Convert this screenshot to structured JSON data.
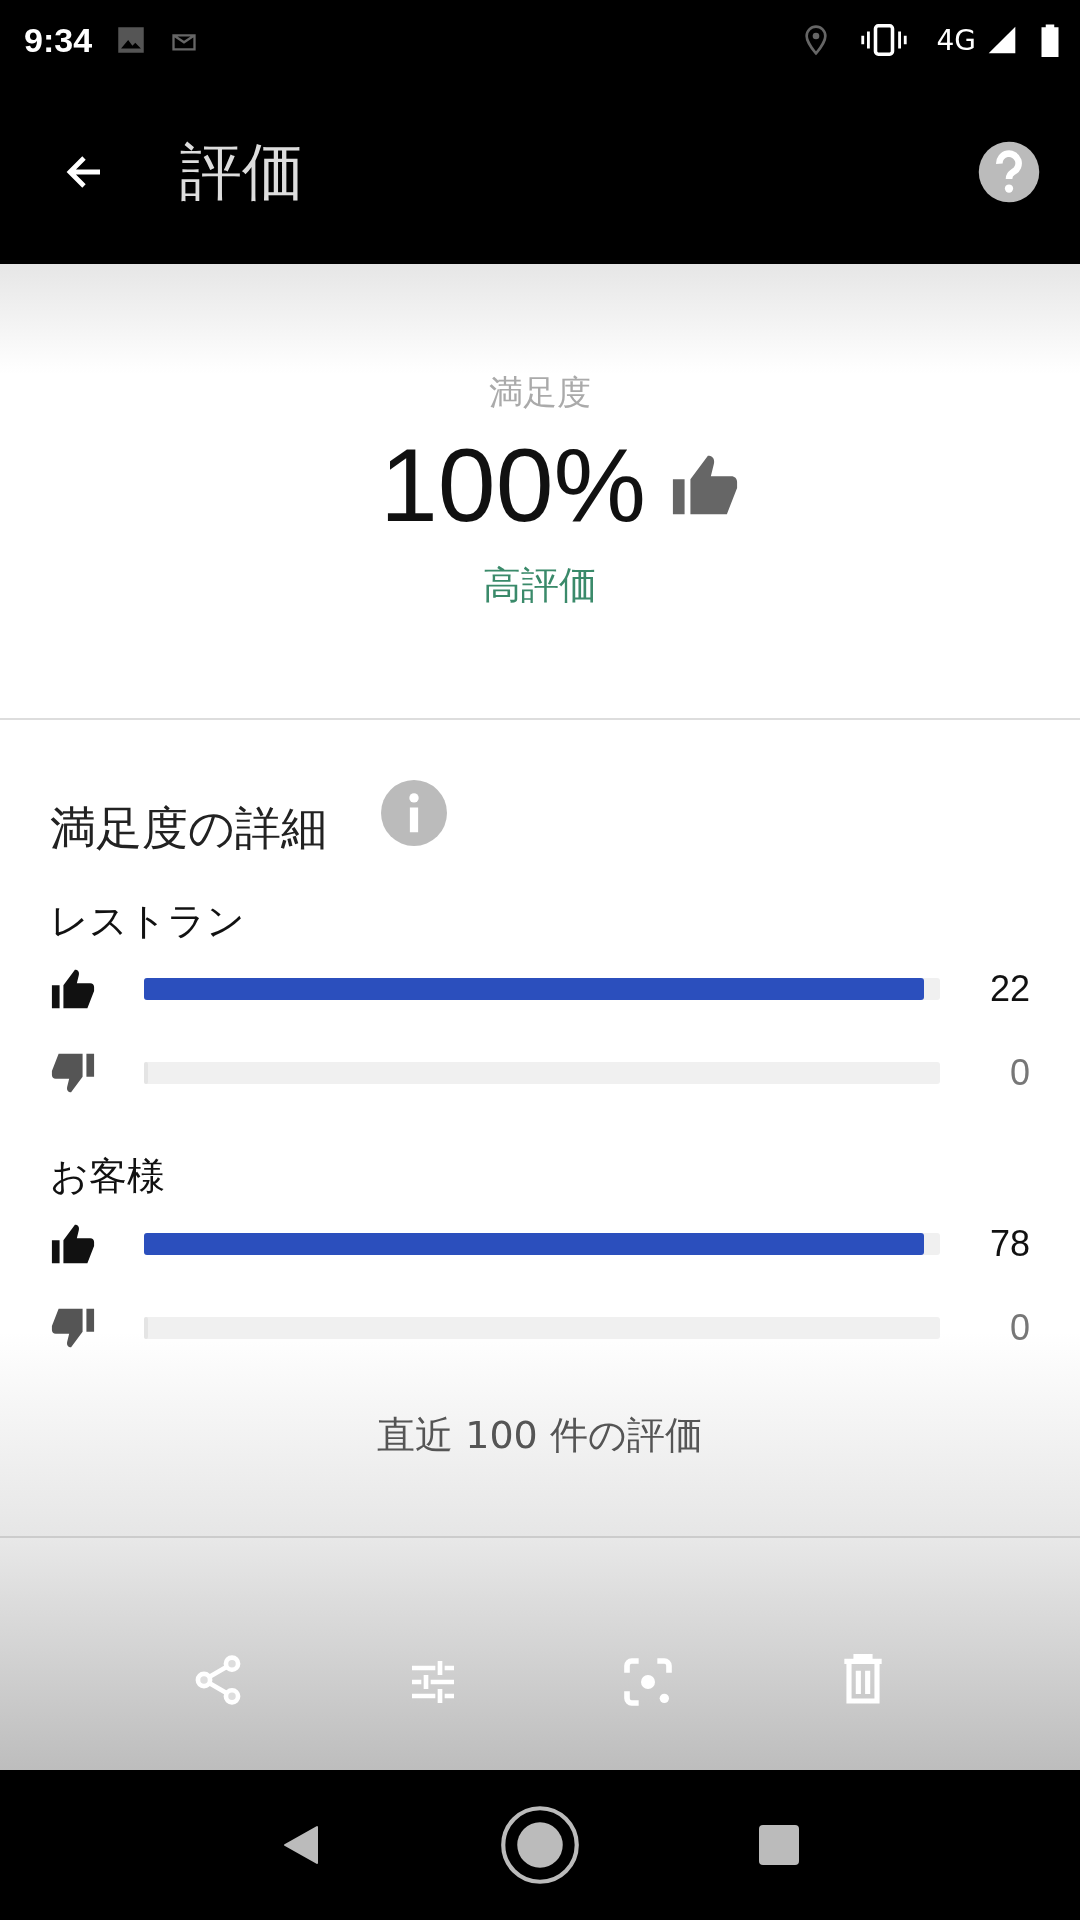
{
  "status_bar": {
    "time": "9:34",
    "network": "4G"
  },
  "app_bar": {
    "title": "評価"
  },
  "summary": {
    "label": "満足度",
    "value": "100%",
    "rating": "高評価"
  },
  "details": {
    "title": "満足度の詳細",
    "groups": [
      {
        "name": "レストラン",
        "rows": [
          {
            "kind": "up",
            "level": 1,
            "count": "22"
          },
          {
            "kind": "down",
            "level": 0,
            "count": "0"
          }
        ]
      },
      {
        "name": "お客様",
        "rows": [
          {
            "kind": "up",
            "level": 1,
            "count": "78"
          },
          {
            "kind": "down",
            "level": 0,
            "count": "0"
          }
        ]
      }
    ]
  },
  "footer": "直近 100 件の評価"
}
